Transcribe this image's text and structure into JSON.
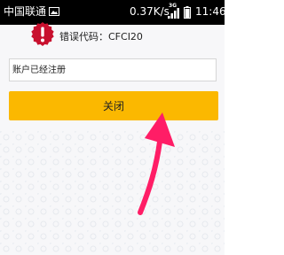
{
  "status_bar": {
    "carrier": "中国联通",
    "speed": "0.37K/s",
    "network_type": "3G",
    "time": "11:46",
    "icons": [
      "image-icon",
      "signal-icon",
      "battery-icon"
    ]
  },
  "dialog": {
    "error_code_label": "错误代码：CFCI20",
    "message": "账户已经注册",
    "close_label": "关闭",
    "error_icon": "exclamation-icon"
  },
  "colors": {
    "button": "#fbb800",
    "error_icon": "#c8102e",
    "arrow": "#ff1d66"
  }
}
